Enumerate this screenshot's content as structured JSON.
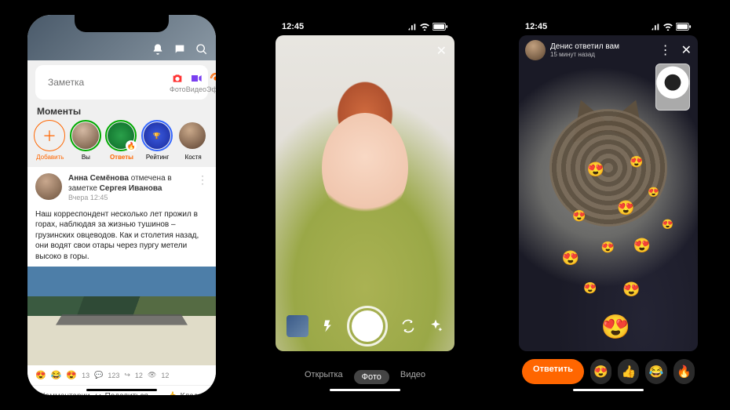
{
  "status_bar": {
    "time": "12:45"
  },
  "phone1": {
    "compose": {
      "placeholder": "Заметка",
      "photo_label": "Фото",
      "video_label": "Видео",
      "live_label": "Эфир"
    },
    "moments": {
      "header": "Моменты",
      "items": [
        {
          "label": "Добавить",
          "kind": "add"
        },
        {
          "label": "Вы"
        },
        {
          "label": "Ответы"
        },
        {
          "label": "Рейтинг"
        },
        {
          "label": "Костя"
        }
      ]
    },
    "feed": {
      "head_html": "Анна Семёнова отмечена в заметке Сергея Иванова",
      "name_a": "Анна Семёнова",
      "mid": " отмечена в заметке ",
      "name_b": "Сергея Иванова",
      "time": "Вчера 12:45",
      "body": "Наш корреспондент несколько лет прожил в горах, наблюдая за жизнью тушинов – грузинских овцеводов. Как и столетия назад, они водят свои отары через пургу метели высоко в горы.",
      "reactions_count": "13",
      "comments_count": "123",
      "shares_count": "12",
      "views_count": "12",
      "action_comments": "Комментарии",
      "action_share": "Поделиться",
      "action_like": "Класс"
    }
  },
  "phone2": {
    "modes": {
      "postcard": "Открытка",
      "photo": "Фото",
      "video": "Видео"
    }
  },
  "phone3": {
    "header": {
      "title": "Денис ответил вам",
      "subtitle": "15 минут назад"
    },
    "reply_button": "Ответить",
    "reactions": [
      "😍",
      "👍",
      "😂",
      "🔥"
    ]
  }
}
